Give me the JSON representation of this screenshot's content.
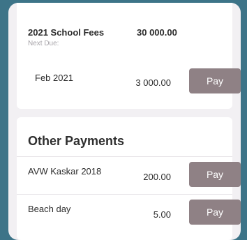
{
  "school_fees": {
    "title": "2021 School Fees",
    "total": "30 000.00",
    "next_due_label": "Next Due:",
    "installment": {
      "label": "Feb 2021",
      "amount": "3 000.00",
      "button": "Pay"
    }
  },
  "other_payments": {
    "title": "Other Payments",
    "items": [
      {
        "label": "AVW Kaskar 2018",
        "amount": "200.00",
        "button": "Pay"
      },
      {
        "label": "Beach day",
        "amount": "5.00",
        "button": "Pay"
      }
    ]
  }
}
